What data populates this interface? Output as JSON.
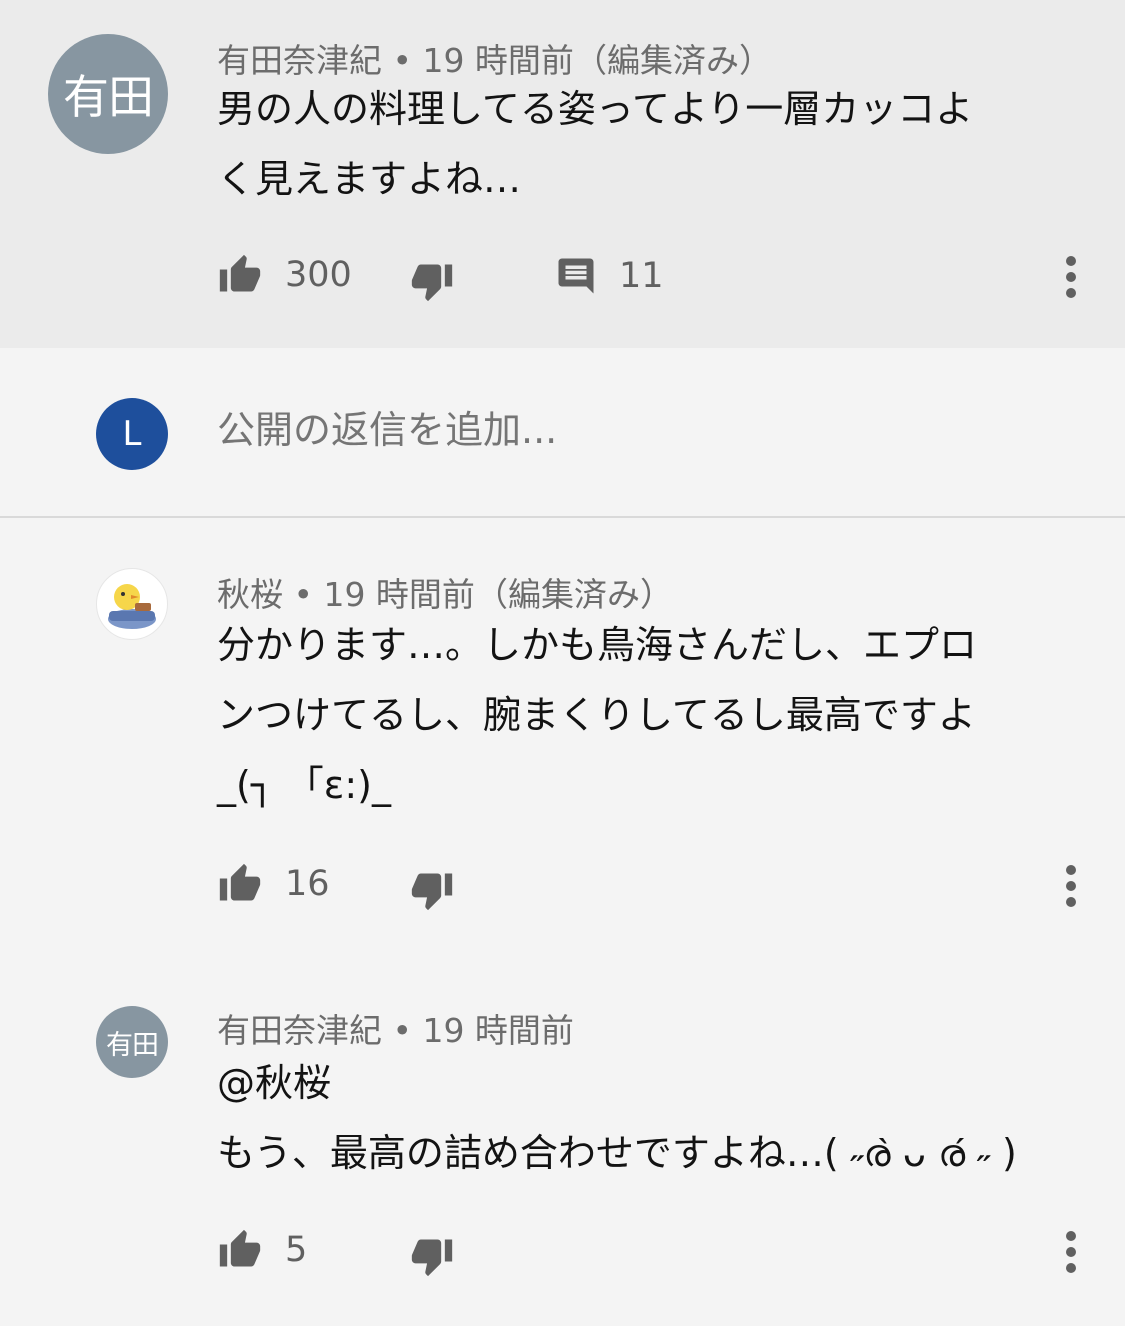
{
  "main_comment": {
    "avatar_text": "有田",
    "author": "有田奈津紀",
    "separator": " • ",
    "time": "19 時間前",
    "edited": "（編集済み）",
    "lines": [
      "男の人の料理してる姿ってより一層カッコよ",
      "く見えますよね…"
    ],
    "likes": "300",
    "replies": "11",
    "icons": {
      "like": "thumbs-up-icon",
      "dislike": "thumbs-down-icon",
      "reply": "comment-icon",
      "more": "more-vert-icon"
    }
  },
  "reply_box": {
    "avatar_text": "L",
    "placeholder": "公開の返信を追加..."
  },
  "replies": [
    {
      "author": "秋桜",
      "separator": " • ",
      "time": "19 時間前",
      "edited": "（編集済み）",
      "lines": [
        "分かります…。しかも鳥海さんだし、エプロ",
        "ンつけてるし、腕まくりしてるし最高ですよ",
        "_(┐ 「ε:)_"
      ],
      "likes": "16"
    },
    {
      "avatar_text": "有田",
      "author": "有田奈津紀",
      "separator": " • ",
      "time": "19 時間前",
      "lines": [
        "@秋桜",
        "もう、最高の詰め合わせですよね…( ˶ര̀ ᴗ ര́ ˶ )"
      ],
      "likes": "5"
    }
  ],
  "colors": {
    "main_bg": "#ebebeb",
    "page_bg": "#f4f4f4",
    "arita_avatar": "#8796a1",
    "l_avatar": "#1e4f9c",
    "icon": "#606060"
  }
}
